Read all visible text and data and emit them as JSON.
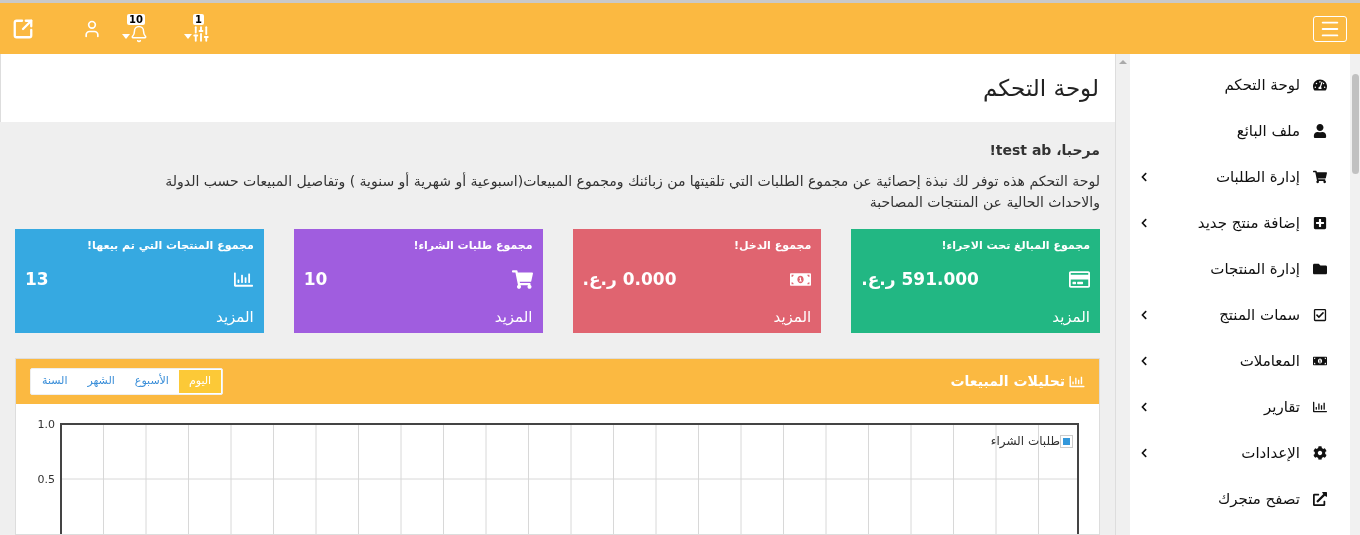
{
  "topbar": {
    "notifications_badge": "10",
    "settings_badge": "1"
  },
  "page_title": "لوحة التحكم",
  "welcome": {
    "title": "مرحبا، test ab!",
    "text": "لوحة التحكم هذه توفر لك نبذة إحصائية عن مجموع الطلبات التي تلقيتها من زبائنك ومجموع المبيعات(اسبوعية أو شهرية أو سنوية ) وتفاصيل المبيعات حسب الدولة والاحداث الحالية عن المنتجات المصاحبة"
  },
  "stat_cards": [
    {
      "title": "مجموع المبالغ تحت الاجراء!",
      "value": "591.000 ر.ع.",
      "more": "المزيد",
      "kind": "card",
      "color": "#22b783"
    },
    {
      "title": "مجموع الدخل!",
      "value": "0.000 ر.ع.",
      "more": "المزيد",
      "kind": "money",
      "color": "#e06470"
    },
    {
      "title": "مجموع طلبات الشراء!",
      "value": "10",
      "more": "المزيد",
      "kind": "cart",
      "color": "#a05ddf"
    },
    {
      "title": "مجموع المنتجات التي تم بيعها!",
      "value": "13",
      "more": "المزيد",
      "kind": "chart",
      "color": "#36a9e1"
    }
  ],
  "sales_panel": {
    "title": "تحليلات المبيعات",
    "tabs": [
      {
        "label": "اليوم",
        "selected": true
      },
      {
        "label": "الأسبوع",
        "selected": false
      },
      {
        "label": "الشهر",
        "selected": false
      },
      {
        "label": "السنة",
        "selected": false
      }
    ],
    "chart_data": {
      "type": "line",
      "ylim": [
        0,
        1
      ],
      "yticks": [
        {
          "value": 1,
          "label": "1.0"
        },
        {
          "value": 0.5,
          "label": "0.5"
        }
      ],
      "series": [
        {
          "name": "طلبات الشراء",
          "color": "#3498db"
        }
      ]
    }
  },
  "sidebar": {
    "items": [
      {
        "label": "لوحة التحكم",
        "kind": "gauge",
        "expandable": false
      },
      {
        "label": "ملف البائع",
        "kind": "user",
        "expandable": false
      },
      {
        "label": "إدارة الطلبات",
        "kind": "cart",
        "expandable": true
      },
      {
        "label": "إضافة منتج جديد",
        "kind": "plus",
        "expandable": true
      },
      {
        "label": "إدارة المنتجات",
        "kind": "folder",
        "expandable": false
      },
      {
        "label": "سمات المنتج",
        "kind": "check",
        "expandable": true
      },
      {
        "label": "المعاملات",
        "kind": "money",
        "expandable": true
      },
      {
        "label": "تقارير",
        "kind": "chart",
        "expandable": true
      },
      {
        "label": "الإعدادات",
        "kind": "gear",
        "expandable": true
      },
      {
        "label": "تصفح متجرك",
        "kind": "external",
        "expandable": false
      }
    ]
  }
}
